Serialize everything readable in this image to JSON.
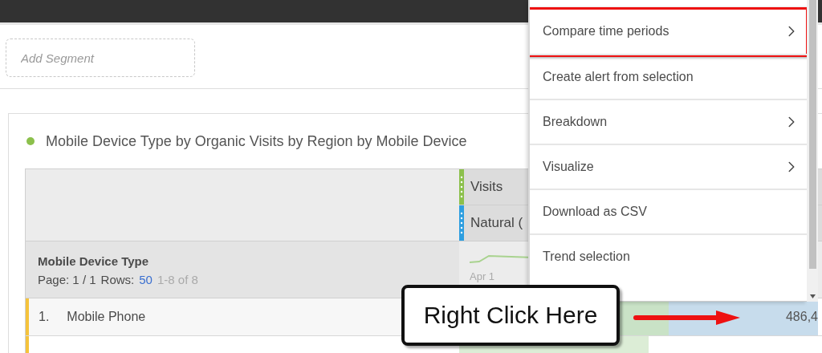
{
  "segment_field": {
    "placeholder": "Add Segment"
  },
  "panel": {
    "title": "Mobile Device Type by Organic Visits by Region by Mobile Device"
  },
  "table": {
    "metrics": [
      {
        "label": "Visits",
        "color": "#8cc04c"
      },
      {
        "label": "Natural (",
        "color": "#2d9ee0"
      }
    ],
    "dimension": {
      "title": "Mobile Device Type",
      "page": "Page: 1 / 1",
      "rows_label": "Rows:",
      "rows_value": "50",
      "range": "1-8 of 8"
    },
    "sparkline_label": "Apr 1",
    "rows": [
      {
        "number": "1.",
        "name": "Mobile Phone",
        "value": "486,4"
      }
    ]
  },
  "context_menu": {
    "items": [
      {
        "label": "Compare time periods",
        "submenu": true,
        "highlighted": true
      },
      {
        "label": "Create alert from selection",
        "submenu": false,
        "highlighted": false
      },
      {
        "label": "Breakdown",
        "submenu": true,
        "highlighted": false
      },
      {
        "label": "Visualize",
        "submenu": true,
        "highlighted": false
      },
      {
        "label": "Download as CSV",
        "submenu": false,
        "highlighted": false
      },
      {
        "label": "Trend selection",
        "submenu": false,
        "highlighted": false
      }
    ]
  },
  "callout": {
    "text": "Right Click Here"
  }
}
